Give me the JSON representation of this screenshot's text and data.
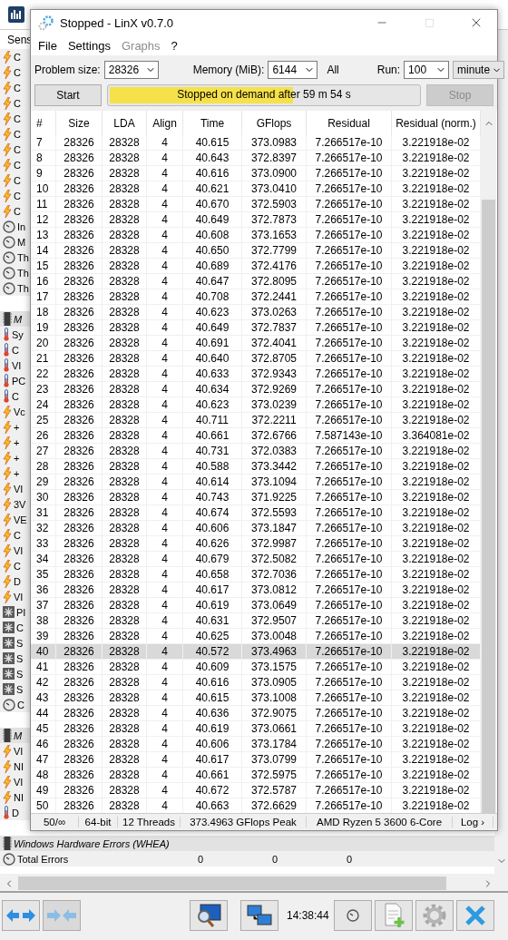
{
  "background_window": {
    "sensor_header": "Sens",
    "sensors": [
      {
        "kind": "voltage",
        "label": "C"
      },
      {
        "kind": "voltage",
        "label": "C"
      },
      {
        "kind": "voltage",
        "label": "C"
      },
      {
        "kind": "voltage",
        "label": "C"
      },
      {
        "kind": "voltage",
        "label": "C"
      },
      {
        "kind": "voltage",
        "label": "C"
      },
      {
        "kind": "voltage",
        "label": "C"
      },
      {
        "kind": "voltage",
        "label": "C"
      },
      {
        "kind": "voltage",
        "label": "C"
      },
      {
        "kind": "voltage",
        "label": "C"
      },
      {
        "kind": "voltage",
        "label": "C"
      },
      {
        "kind": "clock",
        "label": "In"
      },
      {
        "kind": "clock",
        "label": "M"
      },
      {
        "kind": "clock",
        "label": "Th"
      },
      {
        "kind": "clock",
        "label": "Th"
      },
      {
        "kind": "clock",
        "label": "Th"
      },
      {
        "kind": "spacer"
      },
      {
        "kind": "group",
        "label": "M"
      },
      {
        "kind": "temp",
        "label": "Sy"
      },
      {
        "kind": "temp",
        "label": "C"
      },
      {
        "kind": "temp",
        "label": "VI"
      },
      {
        "kind": "temp",
        "label": "PC"
      },
      {
        "kind": "temp",
        "label": "C"
      },
      {
        "kind": "voltage",
        "label": "Vc"
      },
      {
        "kind": "voltage",
        "label": "+"
      },
      {
        "kind": "voltage",
        "label": "+"
      },
      {
        "kind": "voltage",
        "label": "+"
      },
      {
        "kind": "voltage",
        "label": "+"
      },
      {
        "kind": "voltage",
        "label": "VI"
      },
      {
        "kind": "voltage",
        "label": "3V"
      },
      {
        "kind": "voltage",
        "label": "VE"
      },
      {
        "kind": "voltage",
        "label": "C"
      },
      {
        "kind": "voltage",
        "label": "VI"
      },
      {
        "kind": "voltage",
        "label": "C"
      },
      {
        "kind": "voltage",
        "label": "D"
      },
      {
        "kind": "voltage",
        "label": "VI"
      },
      {
        "kind": "fan",
        "label": "PI"
      },
      {
        "kind": "fan",
        "label": "C"
      },
      {
        "kind": "fan",
        "label": "S"
      },
      {
        "kind": "fan",
        "label": "S"
      },
      {
        "kind": "fan",
        "label": "S"
      },
      {
        "kind": "fan",
        "label": "S"
      },
      {
        "kind": "clock",
        "label": "C"
      },
      {
        "kind": "spacer"
      },
      {
        "kind": "group",
        "label": "M"
      },
      {
        "kind": "voltage",
        "label": "VI"
      },
      {
        "kind": "voltage",
        "label": "NI"
      },
      {
        "kind": "voltage",
        "label": "VI"
      },
      {
        "kind": "voltage",
        "label": "NI"
      },
      {
        "kind": "temp",
        "label": "D"
      }
    ],
    "whea_group": "Windows Hardware Errors (WHEA)",
    "total_errors": {
      "label": "Total Errors",
      "values": [
        "0",
        "0",
        "0"
      ]
    },
    "clock": "14:38:44"
  },
  "linx": {
    "title": "Stopped - LinX v0.7.0",
    "menu": [
      {
        "label": "File",
        "disabled": false
      },
      {
        "label": "Settings",
        "disabled": false
      },
      {
        "label": "Graphs",
        "disabled": true
      },
      {
        "label": "?",
        "disabled": false
      }
    ],
    "problem_size": {
      "label": "Problem size:",
      "value": "28326"
    },
    "memory": {
      "label": "Memory (MiB):",
      "value": "6144"
    },
    "all_label": "All",
    "run": {
      "label": "Run:",
      "value": "100"
    },
    "run_unit": {
      "value": "minute"
    },
    "start_button": {
      "label": "Start",
      "disabled": false
    },
    "progress": {
      "text": "Stopped on demand after 59 m 54 s",
      "level": 0.6
    },
    "stop_button": {
      "label": "Stop",
      "disabled": true
    },
    "columns": [
      "#",
      "Size",
      "LDA",
      "Align",
      "Time",
      "GFlops",
      "Residual",
      "Residual (norm.)"
    ],
    "rows": [
      {
        "cells": [
          "7",
          "28326",
          "28328",
          "4",
          "40.615",
          "373.0983",
          "7.266517e-10",
          "3.221918e-02"
        ],
        "selected": false
      },
      {
        "cells": [
          "8",
          "28326",
          "28328",
          "4",
          "40.643",
          "372.8397",
          "7.266517e-10",
          "3.221918e-02"
        ],
        "selected": false
      },
      {
        "cells": [
          "9",
          "28326",
          "28328",
          "4",
          "40.616",
          "373.0900",
          "7.266517e-10",
          "3.221918e-02"
        ],
        "selected": false
      },
      {
        "cells": [
          "10",
          "28326",
          "28328",
          "4",
          "40.621",
          "373.0410",
          "7.266517e-10",
          "3.221918e-02"
        ],
        "selected": false
      },
      {
        "cells": [
          "11",
          "28326",
          "28328",
          "4",
          "40.670",
          "372.5903",
          "7.266517e-10",
          "3.221918e-02"
        ],
        "selected": false
      },
      {
        "cells": [
          "12",
          "28326",
          "28328",
          "4",
          "40.649",
          "372.7873",
          "7.266517e-10",
          "3.221918e-02"
        ],
        "selected": false
      },
      {
        "cells": [
          "13",
          "28326",
          "28328",
          "4",
          "40.608",
          "373.1653",
          "7.266517e-10",
          "3.221918e-02"
        ],
        "selected": false
      },
      {
        "cells": [
          "14",
          "28326",
          "28328",
          "4",
          "40.650",
          "372.7799",
          "7.266517e-10",
          "3.221918e-02"
        ],
        "selected": false
      },
      {
        "cells": [
          "15",
          "28326",
          "28328",
          "4",
          "40.689",
          "372.4176",
          "7.266517e-10",
          "3.221918e-02"
        ],
        "selected": false
      },
      {
        "cells": [
          "16",
          "28326",
          "28328",
          "4",
          "40.647",
          "372.8095",
          "7.266517e-10",
          "3.221918e-02"
        ],
        "selected": false
      },
      {
        "cells": [
          "17",
          "28326",
          "28328",
          "4",
          "40.708",
          "372.2441",
          "7.266517e-10",
          "3.221918e-02"
        ],
        "selected": false
      },
      {
        "cells": [
          "18",
          "28326",
          "28328",
          "4",
          "40.623",
          "373.0263",
          "7.266517e-10",
          "3.221918e-02"
        ],
        "selected": false
      },
      {
        "cells": [
          "19",
          "28326",
          "28328",
          "4",
          "40.649",
          "372.7837",
          "7.266517e-10",
          "3.221918e-02"
        ],
        "selected": false
      },
      {
        "cells": [
          "20",
          "28326",
          "28328",
          "4",
          "40.691",
          "372.4041",
          "7.266517e-10",
          "3.221918e-02"
        ],
        "selected": false
      },
      {
        "cells": [
          "21",
          "28326",
          "28328",
          "4",
          "40.640",
          "372.8705",
          "7.266517e-10",
          "3.221918e-02"
        ],
        "selected": false
      },
      {
        "cells": [
          "22",
          "28326",
          "28328",
          "4",
          "40.633",
          "372.9343",
          "7.266517e-10",
          "3.221918e-02"
        ],
        "selected": false
      },
      {
        "cells": [
          "23",
          "28326",
          "28328",
          "4",
          "40.634",
          "372.9269",
          "7.266517e-10",
          "3.221918e-02"
        ],
        "selected": false
      },
      {
        "cells": [
          "24",
          "28326",
          "28328",
          "4",
          "40.623",
          "373.0239",
          "7.266517e-10",
          "3.221918e-02"
        ],
        "selected": false
      },
      {
        "cells": [
          "25",
          "28326",
          "28328",
          "4",
          "40.711",
          "372.2211",
          "7.266517e-10",
          "3.221918e-02"
        ],
        "selected": false
      },
      {
        "cells": [
          "26",
          "28326",
          "28328",
          "4",
          "40.661",
          "372.6766",
          "7.587143e-10",
          "3.364081e-02"
        ],
        "selected": false
      },
      {
        "cells": [
          "27",
          "28326",
          "28328",
          "4",
          "40.731",
          "372.0383",
          "7.266517e-10",
          "3.221918e-02"
        ],
        "selected": false
      },
      {
        "cells": [
          "28",
          "28326",
          "28328",
          "4",
          "40.588",
          "373.3442",
          "7.266517e-10",
          "3.221918e-02"
        ],
        "selected": false
      },
      {
        "cells": [
          "29",
          "28326",
          "28328",
          "4",
          "40.614",
          "373.1094",
          "7.266517e-10",
          "3.221918e-02"
        ],
        "selected": false
      },
      {
        "cells": [
          "30",
          "28326",
          "28328",
          "4",
          "40.743",
          "371.9225",
          "7.266517e-10",
          "3.221918e-02"
        ],
        "selected": false
      },
      {
        "cells": [
          "31",
          "28326",
          "28328",
          "4",
          "40.674",
          "372.5593",
          "7.266517e-10",
          "3.221918e-02"
        ],
        "selected": false
      },
      {
        "cells": [
          "32",
          "28326",
          "28328",
          "4",
          "40.606",
          "373.1847",
          "7.266517e-10",
          "3.221918e-02"
        ],
        "selected": false
      },
      {
        "cells": [
          "33",
          "28326",
          "28328",
          "4",
          "40.626",
          "372.9987",
          "7.266517e-10",
          "3.221918e-02"
        ],
        "selected": false
      },
      {
        "cells": [
          "34",
          "28326",
          "28328",
          "4",
          "40.679",
          "372.5082",
          "7.266517e-10",
          "3.221918e-02"
        ],
        "selected": false
      },
      {
        "cells": [
          "35",
          "28326",
          "28328",
          "4",
          "40.658",
          "372.7036",
          "7.266517e-10",
          "3.221918e-02"
        ],
        "selected": false
      },
      {
        "cells": [
          "36",
          "28326",
          "28328",
          "4",
          "40.617",
          "373.0812",
          "7.266517e-10",
          "3.221918e-02"
        ],
        "selected": false
      },
      {
        "cells": [
          "37",
          "28326",
          "28328",
          "4",
          "40.619",
          "373.0649",
          "7.266517e-10",
          "3.221918e-02"
        ],
        "selected": false
      },
      {
        "cells": [
          "38",
          "28326",
          "28328",
          "4",
          "40.631",
          "372.9507",
          "7.266517e-10",
          "3.221918e-02"
        ],
        "selected": false
      },
      {
        "cells": [
          "39",
          "28326",
          "28328",
          "4",
          "40.625",
          "373.0048",
          "7.266517e-10",
          "3.221918e-02"
        ],
        "selected": false
      },
      {
        "cells": [
          "40",
          "28326",
          "28328",
          "4",
          "40.572",
          "373.4963",
          "7.266517e-10",
          "3.221918e-02"
        ],
        "selected": true
      },
      {
        "cells": [
          "41",
          "28326",
          "28328",
          "4",
          "40.609",
          "373.1575",
          "7.266517e-10",
          "3.221918e-02"
        ],
        "selected": false
      },
      {
        "cells": [
          "42",
          "28326",
          "28328",
          "4",
          "40.616",
          "373.0905",
          "7.266517e-10",
          "3.221918e-02"
        ],
        "selected": false
      },
      {
        "cells": [
          "43",
          "28326",
          "28328",
          "4",
          "40.615",
          "373.1008",
          "7.266517e-10",
          "3.221918e-02"
        ],
        "selected": false
      },
      {
        "cells": [
          "44",
          "28326",
          "28328",
          "4",
          "40.636",
          "372.9075",
          "7.266517e-10",
          "3.221918e-02"
        ],
        "selected": false
      },
      {
        "cells": [
          "45",
          "28326",
          "28328",
          "4",
          "40.619",
          "373.0661",
          "7.266517e-10",
          "3.221918e-02"
        ],
        "selected": false
      },
      {
        "cells": [
          "46",
          "28326",
          "28328",
          "4",
          "40.606",
          "373.1784",
          "7.266517e-10",
          "3.221918e-02"
        ],
        "selected": false
      },
      {
        "cells": [
          "47",
          "28326",
          "28328",
          "4",
          "40.617",
          "373.0799",
          "7.266517e-10",
          "3.221918e-02"
        ],
        "selected": false
      },
      {
        "cells": [
          "48",
          "28326",
          "28328",
          "4",
          "40.661",
          "372.5975",
          "7.266517e-10",
          "3.221918e-02"
        ],
        "selected": false
      },
      {
        "cells": [
          "49",
          "28326",
          "28328",
          "4",
          "40.672",
          "372.5787",
          "7.266517e-10",
          "3.221918e-02"
        ],
        "selected": false
      },
      {
        "cells": [
          "50",
          "28326",
          "28328",
          "4",
          "40.663",
          "372.6629",
          "7.266517e-10",
          "3.221918e-02"
        ],
        "selected": false
      }
    ],
    "status_bar": [
      "50/∞",
      "64-bit",
      "12 Threads",
      "373.4963 GFlops Peak",
      "AMD Ryzen 5 3600 6-Core",
      "Log ›"
    ]
  }
}
